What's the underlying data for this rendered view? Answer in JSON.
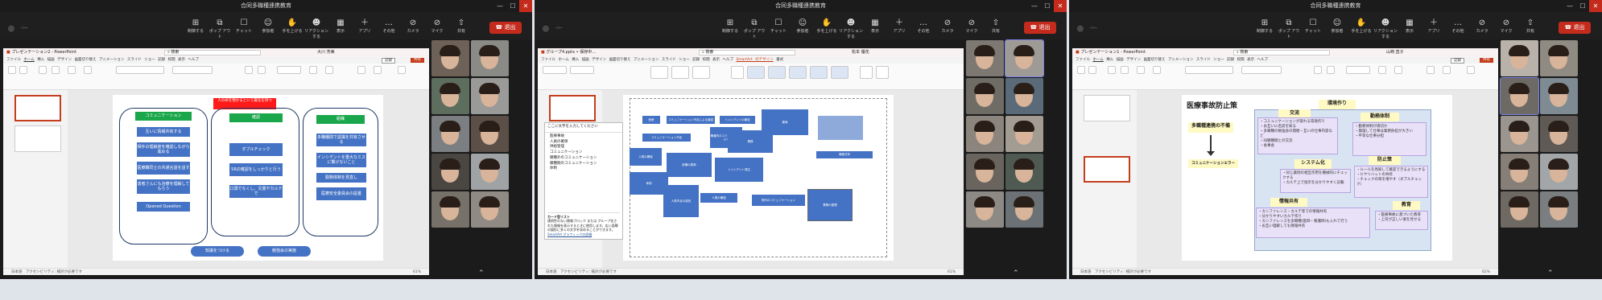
{
  "panels": [
    {
      "title": "合同多職種連携教育",
      "clock": "-:--",
      "ctrl": [
        "制御する",
        "ポップ アウト",
        "チャット",
        "参加者",
        "手を上げる",
        "リアクションする",
        "表示",
        "アプリ",
        "その他",
        "カメラ",
        "マイク",
        "共有"
      ],
      "leave": "退出",
      "app_title": "プレゼンテーション2 - PowerPoint",
      "search": "検索",
      "user": "大川 芳美",
      "record": "記録",
      "share": "共有",
      "tabs": [
        "ファイル",
        "ホーム",
        "挿入",
        "描画",
        "デザイン",
        "画面切り替え",
        "アニメーション",
        "スライド ショー",
        "記録",
        "校閲",
        "表示",
        "ヘルプ"
      ],
      "status": "日本語　アクセシビリティ: 検討が必要です",
      "zoom": "61%",
      "slide": {
        "top_label": "人の命を預かるという責任を持つ",
        "col1_head": "コミュニケーション",
        "col1": [
          "互いに情報共有する",
          "相手の理解度を確認しながら進める",
          "医療職同士の共通言語を話す",
          "患者さんにも治療を理解してもらう",
          "Opened Question"
        ],
        "col2_head": "確認",
        "col2": [
          "ダブルチェック",
          "5Rの確認をしっかりと行う",
          "口頭でなくし、文書やカルテで"
        ],
        "col3_head": "組織",
        "col3": [
          "多職種間で認識を共有させる",
          "インシデントを重大なミスに繋げないこと",
          "勤務体制を見直し",
          "医療安全委員会の設置"
        ],
        "bottom": [
          "知識をつける",
          "勉強会の実施"
        ]
      }
    },
    {
      "title": "合同多職種連携教育",
      "clock": "-:--",
      "ctrl": [
        "制御する",
        "ポップ アウト",
        "チャット",
        "参加者",
        "手を上げる",
        "リアクションする",
        "表示",
        "アプリ",
        "その他",
        "カメラ",
        "マイク",
        "共有"
      ],
      "leave": "退出",
      "app_title": "グループ4.pptx • 保存中...",
      "search": "検索",
      "user": "松本 優花",
      "tabs": [
        "ファイル",
        "ホーム",
        "挿入",
        "描画",
        "デザイン",
        "画面切り替え",
        "アニメーション",
        "スライド ショー",
        "記録",
        "校閲",
        "表示",
        "ヘルプ",
        "SmartArt のデザイン",
        "書式"
      ],
      "status": "日本語　アクセシビリティ: 検討が必要です",
      "zoom": "61%",
      "textpane": {
        "title": "ここに文字を入力してください",
        "items": [
          "医療事故",
          "人員の確保",
          "供給管理",
          "コミュニケーション",
          "職種外のコミュニケーション",
          "職種間のコミュニケーション",
          "体制"
        ],
        "footer_title": "カード型リスト",
        "footer": "連続性のない情報ブロック または グループ化された情報を表示するときに使用します。広い面積の図形に多くの文字を収めることができます。",
        "link": "SmartArt グラフィックの詳細"
      },
      "smartart": [
        "医療",
        "コミュニケーション不足による誤認",
        "インシデントの報告",
        "薬局",
        "コミュニケーション不足",
        "職種内のコミュニケーション",
        "業務",
        "人員の確保",
        "設備の更新",
        "インシデント発生",
        "情報共有",
        "体制",
        "人員不足の負担",
        "人員の確保",
        "院内のコミュニケーション",
        "業務の整理"
      ]
    },
    {
      "title": "合同多職種連携教育",
      "clock": "-:--",
      "ctrl": [
        "制御する",
        "ポップ アウト",
        "チャット",
        "参加者",
        "手を上げる",
        "リアクションする",
        "表示",
        "アプリ",
        "その他",
        "カメラ",
        "マイク",
        "共有"
      ],
      "leave": "退出",
      "app_title": "プレゼンテーション1 - PowerPoint",
      "search": "検索",
      "user": "山崎 直子",
      "record": "記録",
      "share": "共有",
      "tabs": [
        "ファイル",
        "ホーム",
        "挿入",
        "描画",
        "デザイン",
        "画面切り替え",
        "アニメーション",
        "スライド ショー",
        "記録",
        "校閲",
        "表示",
        "ヘルプ"
      ],
      "status": "日本語　アクセシビリティ: 検討が必要です",
      "zoom": "62%",
      "slide": {
        "title": "医療事故防止策",
        "cause": "多職種連携の不備",
        "result": "コミュニケーションエラー",
        "env": "環境作り",
        "kouryu": "交流",
        "kouryu_items": [
          "・コミュニケーションが取れる環境作り",
          "・お互いに名前を知る",
          "・多職種の勉強会の開催・互いの仕事内容など",
          "・同職種間との交流",
          "・食事会"
        ],
        "kinmu": "勤務体制",
        "kinmu_items": [
          "・勤務体制が適切か",
          "・無理して仕事は業務負担が大きい",
          "・平等な仕事分担"
        ],
        "system": "システム化",
        "system_items": [
          "・同じ薬剤の相互作用を機械的にチェックする",
          "・カルテ上で指示を分かりやすく記載"
        ],
        "boushi": "防止策",
        "boushi_items": [
          "・ルールを周知して確認できるようにする",
          "・ヒヤリハットの共有",
          "・チェックの目を増やす（ダブルチェック）"
        ],
        "share": "情報共有",
        "share_items": [
          "・カンファレンス・カルテ等での情報共有",
          "・分かりやすいカルテ作り",
          "・カンファレンスを多職種(医師・看護師)も入れて行う",
          "・お互い理解しても情報共有"
        ],
        "edu": "教育",
        "edu_items": [
          "・医療事故に基づいた教育",
          "・上司が正しい姿を見せる"
        ]
      }
    }
  ],
  "colors": {
    "accent": "#4472c4",
    "leave": "#c42b1c",
    "ppt": "#c43e1c",
    "green": "#1aa64a"
  }
}
